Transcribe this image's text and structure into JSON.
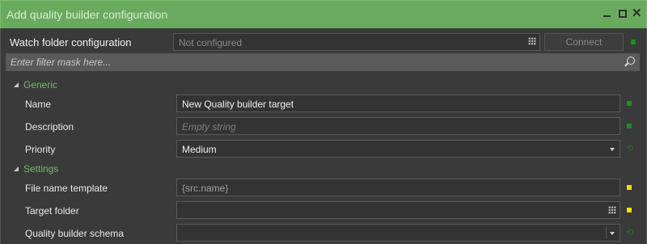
{
  "window": {
    "title": "Add quality builder configuration",
    "minimize_icon": "minimize-icon",
    "maximize_icon": "maximize-icon",
    "close_icon": "close-icon"
  },
  "watch_folder": {
    "label": "Watch folder configuration",
    "placeholder": "Not configured",
    "connect_label": "Connect",
    "status_color": "#1f8c1f"
  },
  "filter": {
    "placeholder": "Enter filter mask here...",
    "icon": "search-icon"
  },
  "groups": {
    "generic": {
      "label": "Generic",
      "rows": {
        "name": {
          "label": "Name",
          "value": "New Quality builder target",
          "status": "green"
        },
        "description": {
          "label": "Description",
          "placeholder": "Empty string",
          "status": "green"
        },
        "priority": {
          "label": "Priority",
          "value": "Medium"
        }
      }
    },
    "settings": {
      "label": "Settings",
      "rows": {
        "file_name_template": {
          "label": "File name template",
          "value": "{src.name}",
          "status": "yellow"
        },
        "target_folder": {
          "label": "Target folder",
          "value": "",
          "status": "yellow"
        },
        "quality_builder_schema": {
          "label": "Quality builder schema",
          "value": ""
        }
      }
    }
  },
  "colors": {
    "accent_green": "#6aaa5e",
    "group_text": "#74b86a",
    "status_green": "#1f8c1f",
    "status_yellow": "#f0e000"
  }
}
